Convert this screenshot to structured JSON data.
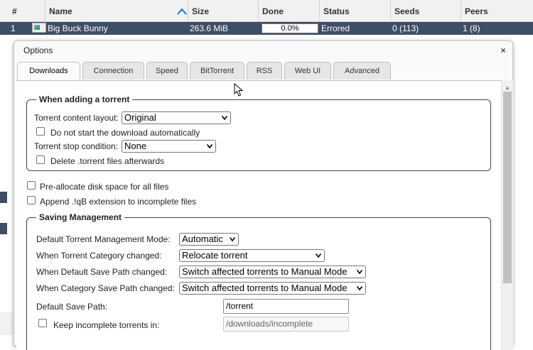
{
  "list": {
    "columns": [
      "#",
      "Name",
      "Size",
      "Done",
      "Status",
      "Seeds",
      "Peers"
    ],
    "row": {
      "index": "1",
      "name": "Big Buck Bunny",
      "size": "263.6 MiB",
      "progress": "0.0%",
      "status": "Errored",
      "seeds": "0 (113)",
      "peers": "1 (8)"
    }
  },
  "dialog": {
    "title": "Options",
    "close": "×",
    "tabs": [
      "Downloads",
      "Connection",
      "Speed",
      "BitTorrent",
      "RSS",
      "Web UI",
      "Advanced"
    ],
    "active_tab": "Downloads",
    "adding": {
      "legend": "When adding a torrent",
      "layout_label": "Torrent content layout:",
      "layout_value": "Original",
      "no_start_label": "Do not start the download automatically",
      "stop_label": "Torrent stop condition:",
      "stop_value": "None",
      "delete_label": "Delete .torrent files afterwards"
    },
    "preallocate_label": "Pre-allocate disk space for all files",
    "append_label": "Append .!qB extension to incomplete files",
    "saving": {
      "legend": "Saving Management",
      "mode_label": "Default Torrent Management Mode:",
      "mode_value": "Automatic",
      "category_changed_label": "When Torrent Category changed:",
      "category_changed_value": "Relocate torrent",
      "default_path_changed_label": "When Default Save Path changed:",
      "default_path_changed_value": "Switch affected torrents to Manual Mode",
      "category_path_changed_label": "When Category Save Path changed:",
      "category_path_changed_value": "Switch affected torrents to Manual Mode",
      "save_path_label": "Default Save Path:",
      "save_path_value": "/torrent",
      "keep_incomplete_label": "Keep incomplete torrents in:",
      "keep_incomplete_value": "/downloads/incomplete"
    }
  },
  "colors": {
    "selected_row": "#3d4e66",
    "accent_arrow": "#1e6fd9"
  }
}
